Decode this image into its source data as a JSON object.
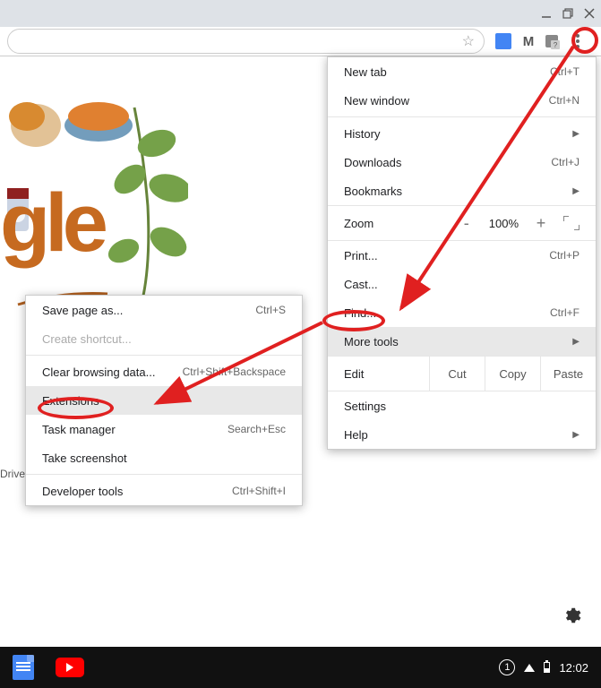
{
  "titlebar": {
    "minimize": "_",
    "maximize": "❐",
    "close": "✕"
  },
  "toolbar": {
    "star": "☆"
  },
  "google_logo_fragment": "gle",
  "drive_text": "Drive",
  "main_menu": {
    "newtab": {
      "label": "New tab",
      "shortcut": "Ctrl+T"
    },
    "newwin": {
      "label": "New window",
      "shortcut": "Ctrl+N"
    },
    "history": {
      "label": "History"
    },
    "downloads": {
      "label": "Downloads",
      "shortcut": "Ctrl+J"
    },
    "bookmarks": {
      "label": "Bookmarks"
    },
    "zoom": {
      "label": "Zoom",
      "minus": "-",
      "value": "100%",
      "plus": "+"
    },
    "print": {
      "label": "Print...",
      "shortcut": "Ctrl+P"
    },
    "cast": {
      "label": "Cast..."
    },
    "find": {
      "label": "Find...",
      "shortcut": "Ctrl+F"
    },
    "moretools": {
      "label": "More tools"
    },
    "edit": {
      "label": "Edit",
      "cut": "Cut",
      "copy": "Copy",
      "paste": "Paste"
    },
    "settings": {
      "label": "Settings"
    },
    "help": {
      "label": "Help"
    }
  },
  "sub_menu": {
    "savepage": {
      "label": "Save page as...",
      "shortcut": "Ctrl+S"
    },
    "createshortcut": {
      "label": "Create shortcut..."
    },
    "clearbrowsing": {
      "label": "Clear browsing data...",
      "shortcut": "Ctrl+Shift+Backspace"
    },
    "extensions": {
      "label": "Extensions"
    },
    "taskmgr": {
      "label": "Task manager",
      "shortcut": "Search+Esc"
    },
    "screenshot": {
      "label": "Take screenshot"
    },
    "devtools": {
      "label": "Developer tools",
      "shortcut": "Ctrl+Shift+I"
    }
  },
  "taskbar": {
    "tab_count": "1",
    "time": "12:02"
  }
}
